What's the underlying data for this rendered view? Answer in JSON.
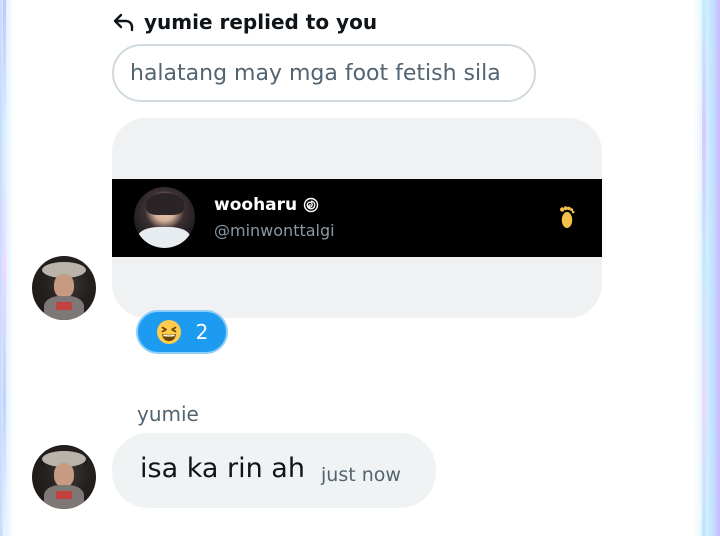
{
  "reply": {
    "header_text": "yumie replied to you",
    "quoted_text": "halatang may mga foot fetish sila"
  },
  "card": {
    "name": "wooharu",
    "name_icon": "spiral-icon",
    "handle": "@minwonttalgi",
    "trailing_icon": "foot-icon"
  },
  "reaction": {
    "emoji": "grinning-squinting-face-icon",
    "count": "2"
  },
  "message": {
    "sender": "yumie",
    "text": "isa ka rin ah",
    "timestamp": "just now"
  },
  "colors": {
    "accent": "#1d9bf0",
    "bubble": "#eff3f4",
    "text_primary": "#0f1419",
    "text_secondary": "#536471"
  }
}
